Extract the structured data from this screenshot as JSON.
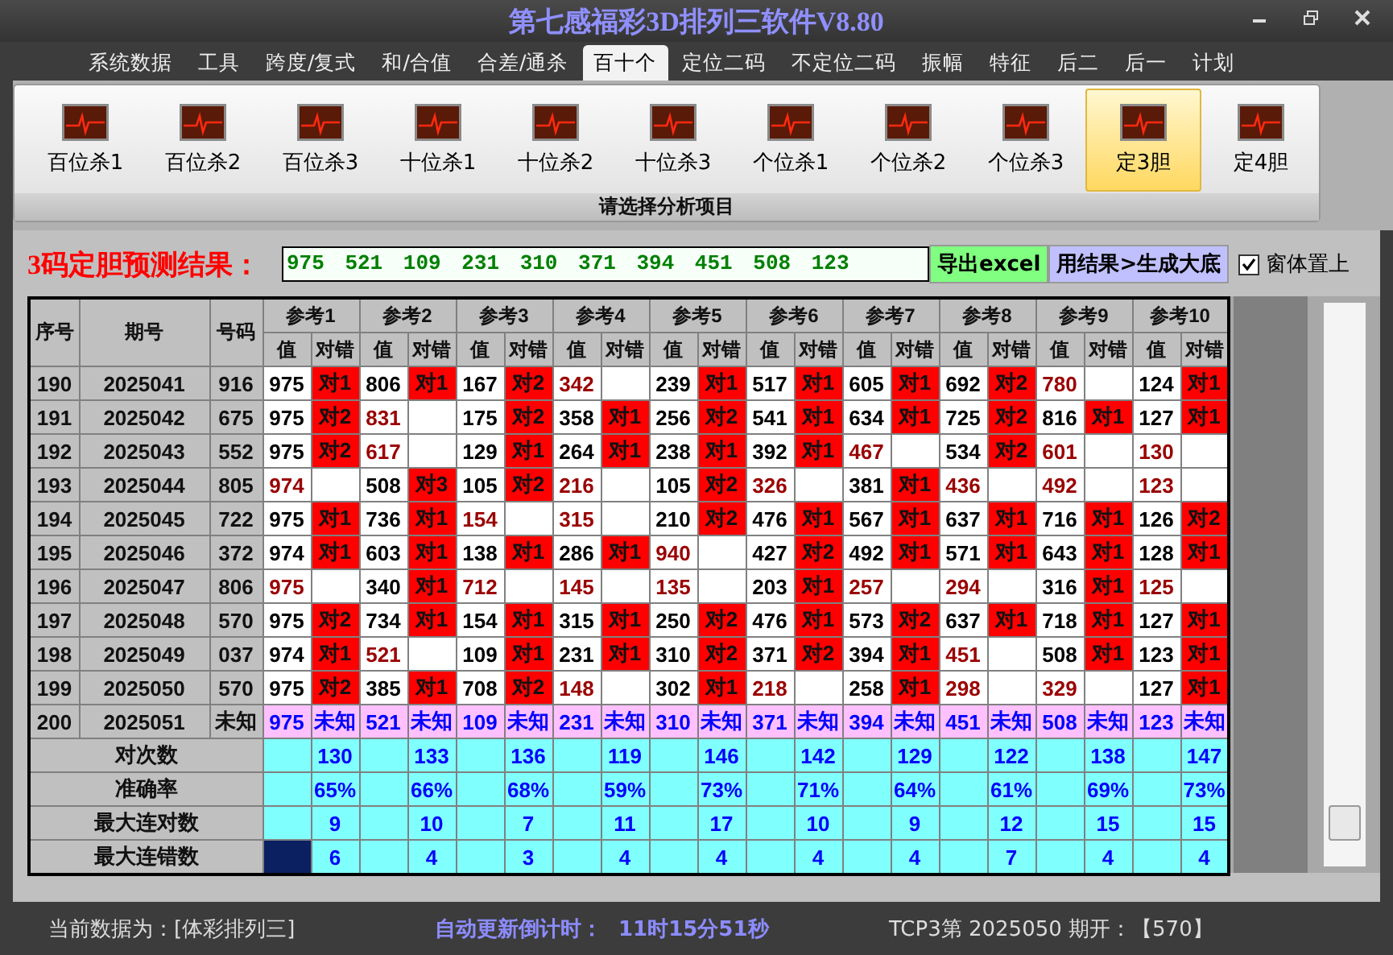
{
  "window": {
    "title": "第七感福彩3D排列三软件V8.80"
  },
  "menu": [
    {
      "label": "系统数据",
      "selected": false
    },
    {
      "label": "工具",
      "selected": false
    },
    {
      "label": "跨度/复式",
      "selected": false
    },
    {
      "label": "和/合值",
      "selected": false
    },
    {
      "label": "合差/通杀",
      "selected": false
    },
    {
      "label": "百十个",
      "selected": true
    },
    {
      "label": "定位二码",
      "selected": false
    },
    {
      "label": "不定位二码",
      "selected": false
    },
    {
      "label": "振幅",
      "selected": false
    },
    {
      "label": "特征",
      "selected": false
    },
    {
      "label": "后二",
      "selected": false
    },
    {
      "label": "后一",
      "selected": false
    },
    {
      "label": "计划",
      "selected": false
    }
  ],
  "ribbon": {
    "items": [
      {
        "label": "百位杀1",
        "selected": false
      },
      {
        "label": "百位杀2",
        "selected": false
      },
      {
        "label": "百位杀3",
        "selected": false
      },
      {
        "label": "十位杀1",
        "selected": false
      },
      {
        "label": "十位杀2",
        "selected": false
      },
      {
        "label": "十位杀3",
        "selected": false
      },
      {
        "label": "个位杀1",
        "selected": false
      },
      {
        "label": "个位杀2",
        "selected": false
      },
      {
        "label": "个位杀3",
        "selected": false
      },
      {
        "label": "定3胆",
        "selected": true
      },
      {
        "label": "定4胆",
        "selected": false
      }
    ],
    "group_label": "请选择分析项目"
  },
  "prediction": {
    "label": "3码定胆预测结果：",
    "value": "975 521 109 231 310 371 394 451 508 123",
    "buttons": [
      "导出excel",
      "用结果>生成大底"
    ],
    "checkbox": {
      "label": "窗体置上",
      "checked": true
    }
  },
  "table": {
    "columns": [
      "序号",
      "期号",
      "号码"
    ],
    "refs": [
      {
        "label": "参考1",
        "sub": [
          "值",
          "对错"
        ]
      },
      {
        "label": "参考2",
        "sub": [
          "值",
          "对错"
        ]
      },
      {
        "label": "参考3",
        "sub": [
          "值",
          "对错"
        ]
      },
      {
        "label": "参考4",
        "sub": [
          "值",
          "对错"
        ]
      },
      {
        "label": "参考5",
        "sub": [
          "值",
          "对错"
        ]
      },
      {
        "label": "参考6",
        "sub": [
          "值",
          "对错"
        ]
      },
      {
        "label": "参考7",
        "sub": [
          "值",
          "对错"
        ]
      },
      {
        "label": "参考8",
        "sub": [
          "值",
          "对错"
        ]
      },
      {
        "label": "参考9",
        "sub": [
          "值",
          "对错"
        ]
      },
      {
        "label": "参考10",
        "sub": [
          "值",
          "对错"
        ]
      }
    ],
    "rows": [
      {
        "kind": "result",
        "index": "190",
        "issue": "2025041",
        "number": "916",
        "cells": [
          {
            "value": "975",
            "hit": true,
            "result": "对1"
          },
          {
            "value": "806",
            "hit": true,
            "result": "对1"
          },
          {
            "value": "167",
            "hit": true,
            "result": "对2"
          },
          {
            "value": "342",
            "hit": false
          },
          {
            "value": "239",
            "hit": true,
            "result": "对1"
          },
          {
            "value": "517",
            "hit": true,
            "result": "对1"
          },
          {
            "value": "605",
            "hit": true,
            "result": "对1"
          },
          {
            "value": "692",
            "hit": true,
            "result": "对2"
          },
          {
            "value": "780",
            "hit": false
          },
          {
            "value": "124",
            "hit": true,
            "result": "对1"
          }
        ]
      },
      {
        "kind": "result",
        "index": "191",
        "issue": "2025042",
        "number": "675",
        "cells": [
          {
            "value": "975",
            "hit": true,
            "result": "对2"
          },
          {
            "value": "831",
            "hit": false
          },
          {
            "value": "175",
            "hit": true,
            "result": "对2"
          },
          {
            "value": "358",
            "hit": true,
            "result": "对1"
          },
          {
            "value": "256",
            "hit": true,
            "result": "对2"
          },
          {
            "value": "541",
            "hit": true,
            "result": "对1"
          },
          {
            "value": "634",
            "hit": true,
            "result": "对1"
          },
          {
            "value": "725",
            "hit": true,
            "result": "对2"
          },
          {
            "value": "816",
            "hit": true,
            "result": "对1"
          },
          {
            "value": "127",
            "hit": true,
            "result": "对1"
          }
        ]
      },
      {
        "kind": "result",
        "index": "192",
        "issue": "2025043",
        "number": "552",
        "cells": [
          {
            "value": "975",
            "hit": true,
            "result": "对2"
          },
          {
            "value": "617",
            "hit": false
          },
          {
            "value": "129",
            "hit": true,
            "result": "对1"
          },
          {
            "value": "264",
            "hit": true,
            "result": "对1"
          },
          {
            "value": "238",
            "hit": true,
            "result": "对1"
          },
          {
            "value": "392",
            "hit": true,
            "result": "对1"
          },
          {
            "value": "467",
            "hit": false
          },
          {
            "value": "534",
            "hit": true,
            "result": "对2"
          },
          {
            "value": "601",
            "hit": false
          },
          {
            "value": "130",
            "hit": false
          }
        ]
      },
      {
        "kind": "result",
        "index": "193",
        "issue": "2025044",
        "number": "805",
        "cells": [
          {
            "value": "974",
            "hit": false
          },
          {
            "value": "508",
            "hit": true,
            "result": "对3"
          },
          {
            "value": "105",
            "hit": true,
            "result": "对2"
          },
          {
            "value": "216",
            "hit": false
          },
          {
            "value": "105",
            "hit": true,
            "result": "对2"
          },
          {
            "value": "326",
            "hit": false
          },
          {
            "value": "381",
            "hit": true,
            "result": "对1"
          },
          {
            "value": "436",
            "hit": false
          },
          {
            "value": "492",
            "hit": false
          },
          {
            "value": "123",
            "hit": false
          }
        ]
      },
      {
        "kind": "result",
        "index": "194",
        "issue": "2025045",
        "number": "722",
        "cells": [
          {
            "value": "975",
            "hit": true,
            "result": "对1"
          },
          {
            "value": "736",
            "hit": true,
            "result": "对1"
          },
          {
            "value": "154",
            "hit": false
          },
          {
            "value": "315",
            "hit": false
          },
          {
            "value": "210",
            "hit": true,
            "result": "对2"
          },
          {
            "value": "476",
            "hit": true,
            "result": "对1"
          },
          {
            "value": "567",
            "hit": true,
            "result": "对1"
          },
          {
            "value": "637",
            "hit": true,
            "result": "对1"
          },
          {
            "value": "716",
            "hit": true,
            "result": "对1"
          },
          {
            "value": "126",
            "hit": true,
            "result": "对2"
          }
        ]
      },
      {
        "kind": "result",
        "index": "195",
        "issue": "2025046",
        "number": "372",
        "cells": [
          {
            "value": "974",
            "hit": true,
            "result": "对1"
          },
          {
            "value": "603",
            "hit": true,
            "result": "对1"
          },
          {
            "value": "138",
            "hit": true,
            "result": "对1"
          },
          {
            "value": "286",
            "hit": true,
            "result": "对1"
          },
          {
            "value": "940",
            "hit": false
          },
          {
            "value": "427",
            "hit": true,
            "result": "对2"
          },
          {
            "value": "492",
            "hit": true,
            "result": "对1"
          },
          {
            "value": "571",
            "hit": true,
            "result": "对1"
          },
          {
            "value": "643",
            "hit": true,
            "result": "对1"
          },
          {
            "value": "128",
            "hit": true,
            "result": "对1"
          }
        ]
      },
      {
        "kind": "result",
        "index": "196",
        "issue": "2025047",
        "number": "806",
        "cells": [
          {
            "value": "975",
            "hit": false
          },
          {
            "value": "340",
            "hit": true,
            "result": "对1"
          },
          {
            "value": "712",
            "hit": false
          },
          {
            "value": "145",
            "hit": false
          },
          {
            "value": "135",
            "hit": false
          },
          {
            "value": "203",
            "hit": true,
            "result": "对1"
          },
          {
            "value": "257",
            "hit": false
          },
          {
            "value": "294",
            "hit": false
          },
          {
            "value": "316",
            "hit": true,
            "result": "对1"
          },
          {
            "value": "125",
            "hit": false
          }
        ]
      },
      {
        "kind": "result",
        "index": "197",
        "issue": "2025048",
        "number": "570",
        "cells": [
          {
            "value": "975",
            "hit": true,
            "result": "对2"
          },
          {
            "value": "734",
            "hit": true,
            "result": "对1"
          },
          {
            "value": "154",
            "hit": true,
            "result": "对1"
          },
          {
            "value": "315",
            "hit": true,
            "result": "对1"
          },
          {
            "value": "250",
            "hit": true,
            "result": "对2"
          },
          {
            "value": "476",
            "hit": true,
            "result": "对1"
          },
          {
            "value": "573",
            "hit": true,
            "result": "对2"
          },
          {
            "value": "637",
            "hit": true,
            "result": "对1"
          },
          {
            "value": "718",
            "hit": true,
            "result": "对1"
          },
          {
            "value": "127",
            "hit": true,
            "result": "对1"
          }
        ]
      },
      {
        "kind": "result",
        "index": "198",
        "issue": "2025049",
        "number": "037",
        "cells": [
          {
            "value": "974",
            "hit": true,
            "result": "对1"
          },
          {
            "value": "521",
            "hit": false
          },
          {
            "value": "109",
            "hit": true,
            "result": "对1"
          },
          {
            "value": "231",
            "hit": true,
            "result": "对1"
          },
          {
            "value": "310",
            "hit": true,
            "result": "对2"
          },
          {
            "value": "371",
            "hit": true,
            "result": "对2"
          },
          {
            "value": "394",
            "hit": true,
            "result": "对1"
          },
          {
            "value": "451",
            "hit": false
          },
          {
            "value": "508",
            "hit": true,
            "result": "对1"
          },
          {
            "value": "123",
            "hit": true,
            "result": "对1"
          }
        ]
      },
      {
        "kind": "result",
        "index": "199",
        "issue": "2025050",
        "number": "570",
        "cells": [
          {
            "value": "975",
            "hit": true,
            "result": "对2"
          },
          {
            "value": "385",
            "hit": true,
            "result": "对1"
          },
          {
            "value": "708",
            "hit": true,
            "result": "对2"
          },
          {
            "value": "148",
            "hit": false
          },
          {
            "value": "302",
            "hit": true,
            "result": "对1"
          },
          {
            "value": "218",
            "hit": false
          },
          {
            "value": "258",
            "hit": true,
            "result": "对1"
          },
          {
            "value": "298",
            "hit": false
          },
          {
            "value": "329",
            "hit": false
          },
          {
            "value": "127",
            "hit": true,
            "result": "对1"
          }
        ]
      },
      {
        "kind": "pending",
        "index": "200",
        "issue": "2025051",
        "number": "未知",
        "cells": [
          {
            "value": "975",
            "result": "未知"
          },
          {
            "value": "521",
            "result": "未知"
          },
          {
            "value": "109",
            "result": "未知"
          },
          {
            "value": "231",
            "result": "未知"
          },
          {
            "value": "310",
            "result": "未知"
          },
          {
            "value": "371",
            "result": "未知"
          },
          {
            "value": "394",
            "result": "未知"
          },
          {
            "value": "451",
            "result": "未知"
          },
          {
            "value": "508",
            "result": "未知"
          },
          {
            "value": "123",
            "result": "未知"
          }
        ]
      }
    ],
    "stats": [
      {
        "label": "对次数",
        "lead_selected": false,
        "values": [
          "130",
          "133",
          "136",
          "119",
          "146",
          "142",
          "129",
          "122",
          "138",
          "147"
        ]
      },
      {
        "label": "准确率",
        "lead_selected": false,
        "values": [
          "65%",
          "66%",
          "68%",
          "59%",
          "73%",
          "71%",
          "64%",
          "61%",
          "69%",
          "73%"
        ]
      },
      {
        "label": "最大连对数",
        "lead_selected": false,
        "values": [
          "9",
          "10",
          "7",
          "11",
          "17",
          "10",
          "9",
          "12",
          "15",
          "15"
        ]
      },
      {
        "label": "最大连错数",
        "lead_selected": true,
        "values": [
          "6",
          "4",
          "3",
          "4",
          "4",
          "4",
          "4",
          "7",
          "4",
          "4"
        ]
      }
    ]
  },
  "status_bar": {
    "data_source": "当前数据为：[体彩排列三]",
    "countdown_label": "自动更新倒计时：",
    "countdown": "11时15分51秒",
    "last_draw": "TCP3第 2025050 期开：【570】"
  }
}
